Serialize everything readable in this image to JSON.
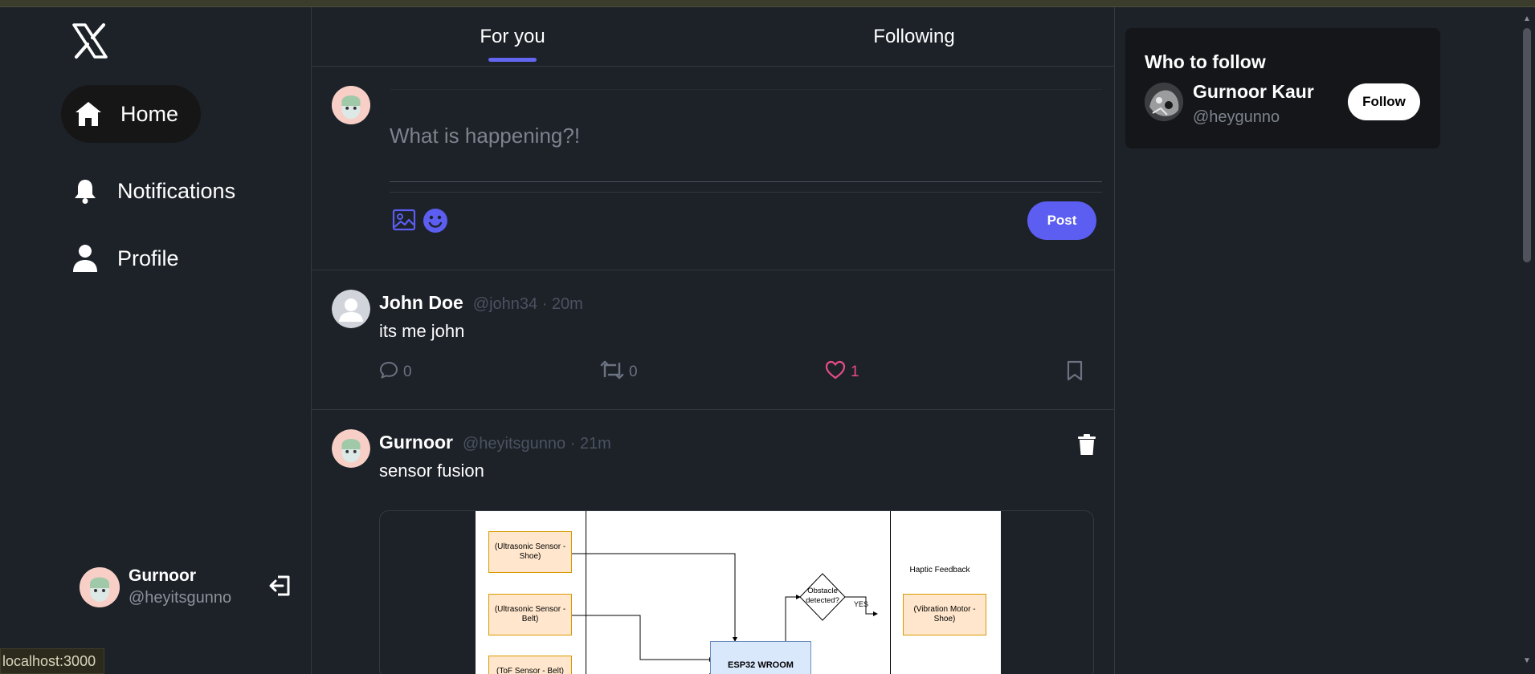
{
  "app": {
    "logo": "X"
  },
  "nav": {
    "home": "Home",
    "notifications": "Notifications",
    "profile": "Profile"
  },
  "current_user": {
    "name": "Gurnoor",
    "handle": "@heyitsgunno"
  },
  "tabs": {
    "for_you": "For you",
    "following": "Following"
  },
  "composer": {
    "placeholder": "What is happening?!",
    "post_label": "Post"
  },
  "tweets": [
    {
      "name": "John Doe",
      "meta": "@john34 · 20m",
      "body": "its me john",
      "replies": "0",
      "retweets": "0",
      "likes": "1"
    },
    {
      "name": "Gurnoor",
      "meta": "@heyitsgunno · 21m",
      "body": "sensor fusion",
      "diagram": {
        "box1": "(Ultrasonic Sensor - Shoe)",
        "box2": "(Ultrasonic Sensor - Belt)",
        "box3": "(ToF Sensor - Belt)",
        "esp": "ESP32 WROOM",
        "decision": "Obstacle detected?",
        "yes": "YES",
        "haptic_title": "Haptic Feedback",
        "haptic_box": "(Vibration Motor - Shoe)"
      }
    }
  ],
  "who_to_follow": {
    "title": "Who to follow",
    "name": "Gurnoor Kaur",
    "handle": "@heygunno",
    "follow_label": "Follow"
  },
  "status_bar": {
    "url": "localhost:3000"
  },
  "colors": {
    "accent": "#5b5ef0",
    "like": "#e64b8b",
    "background": "#1d2128"
  }
}
